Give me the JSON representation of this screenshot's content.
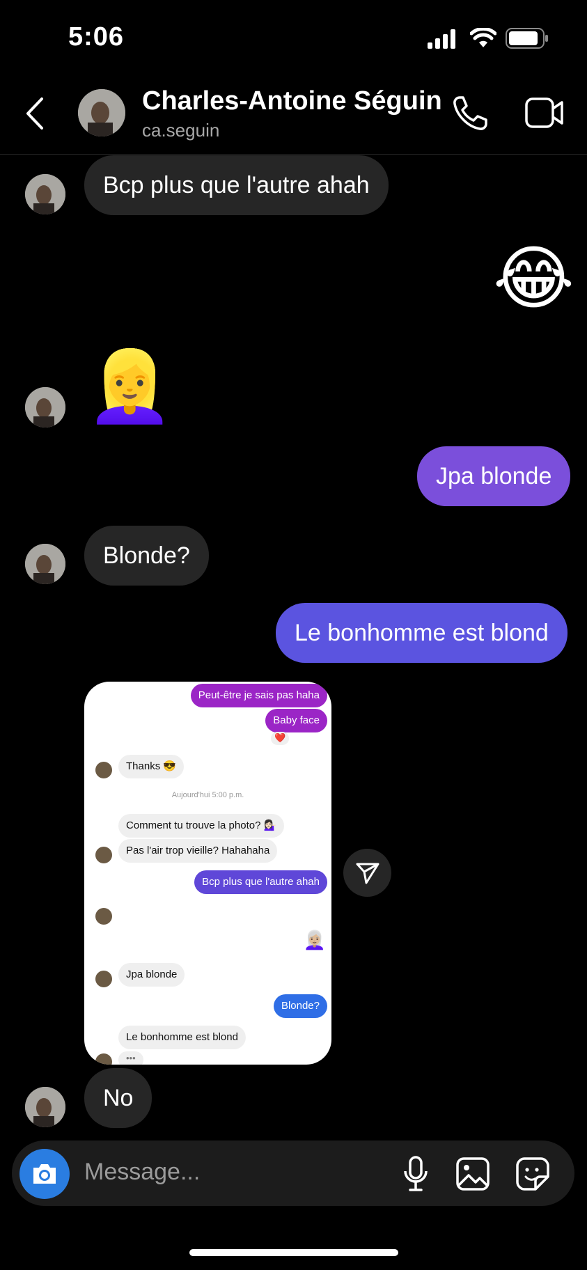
{
  "status_bar": {
    "time": "5:06"
  },
  "header": {
    "name": "Charles-Antoine Séguin",
    "username": "ca.seguin"
  },
  "messages": {
    "m1": "Bcp plus que l'autre ahah",
    "m2_emoji": "😂",
    "m3_emoji": "👱‍♀️",
    "m4": "Jpa blonde",
    "m5": "Blonde?",
    "m6": "Le bonhomme est blond",
    "m7": "No"
  },
  "shared_screenshot": {
    "lines": [
      "Peut-être je sais pas haha",
      "Baby face",
      "❤️",
      "Thanks 😎",
      "Aujourd'hui 5:00 p.m.",
      "Comment tu trouve la photo? 💁🏻‍♀️",
      "Pas l'air trop vieille? Hahahaha",
      "Bcp plus que l'autre ahah",
      "😂",
      "👩🏼‍🦳",
      "Jpa blonde",
      "Blonde?",
      "Le bonhomme est blond",
      "•••"
    ]
  },
  "composer": {
    "placeholder": "Message..."
  },
  "colors": {
    "outgoing_purple": "#7b4fdb",
    "outgoing_indigo": "#5b54e0",
    "camera_blue": "#2a7de1",
    "incoming": "#262626"
  }
}
